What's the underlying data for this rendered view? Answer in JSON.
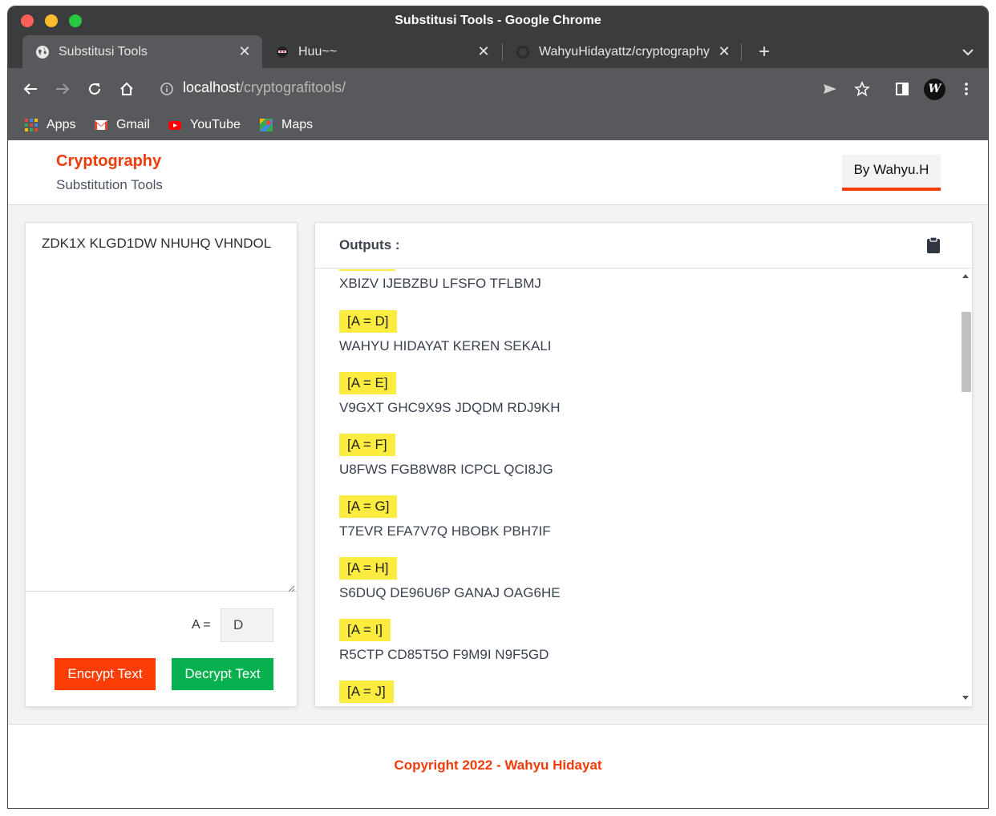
{
  "window": {
    "title": "Substitusi Tools - Google Chrome"
  },
  "tabs": [
    {
      "label": "Substitusi Tools",
      "icon": "globe-icon",
      "active": true
    },
    {
      "label": "Huu~~",
      "icon": "ninja-icon",
      "active": false
    },
    {
      "label": "WahyuHidayattz/cryptography",
      "icon": "github-icon",
      "active": false
    }
  ],
  "toolbar": {
    "url_host": "localhost",
    "url_path": "/cryptografitools/",
    "avatar_letter": "W"
  },
  "bookmarks": [
    {
      "label": "Apps",
      "icon": "apps-grid-icon"
    },
    {
      "label": "Gmail",
      "icon": "gmail-icon"
    },
    {
      "label": "YouTube",
      "icon": "youtube-icon"
    },
    {
      "label": "Maps",
      "icon": "maps-icon"
    }
  ],
  "header": {
    "brand": "Cryptography",
    "subtitle": "Substitution Tools",
    "author_button": "By Wahyu.H"
  },
  "input": {
    "text": "ZDK1X KLGD1DW NHUHQ VHNDOL",
    "key_label": "A =",
    "key_value": "D",
    "encrypt_label": "Encrypt Text",
    "decrypt_label": "Decrypt Text"
  },
  "outputs": {
    "title": "Outputs :",
    "first_cipher": "XBIZV IJEBZBU LFSFO TFLBMJ",
    "items": [
      {
        "key": "[A = D]",
        "text": "WAHYU HIDAYAT KEREN SEKALI"
      },
      {
        "key": "[A = E]",
        "text": "V9GXT GHC9X9S JDQDM RDJ9KH"
      },
      {
        "key": "[A = F]",
        "text": "U8FWS FGB8W8R ICPCL QCI8JG"
      },
      {
        "key": "[A = G]",
        "text": "T7EVR EFA7V7Q HBOBK PBH7IF"
      },
      {
        "key": "[A = H]",
        "text": "S6DUQ DE96U6P GANAJ OAG6HE"
      },
      {
        "key": "[A = I]",
        "text": "R5CTP CD85T5O F9M9I N9F5GD"
      },
      {
        "key": "[A = J]",
        "text": ""
      }
    ]
  },
  "footer": {
    "copyright": "Copyright 2022 - Wahyu Hidayat"
  },
  "colors": {
    "accent": "#f03b0a",
    "encrypt": "#fc3d05",
    "decrypt": "#07b04e",
    "highlight": "#fcec3f"
  }
}
